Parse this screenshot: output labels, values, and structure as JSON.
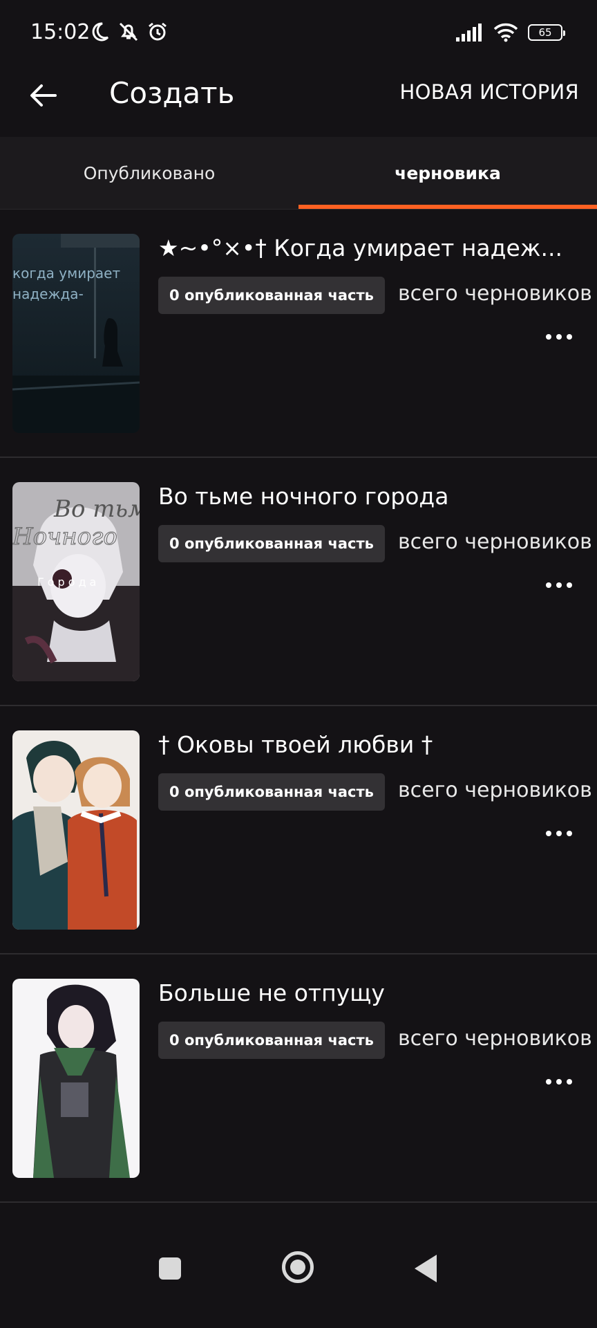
{
  "status_bar": {
    "time": "15:02",
    "battery": "65",
    "icons_left": [
      "moon-icon",
      "bell-off-icon",
      "alarm-icon"
    ],
    "icons_right": [
      "signal-icon",
      "wifi-icon",
      "battery-icon"
    ]
  },
  "app_bar": {
    "title": "Создать",
    "action_label": "НОВАЯ ИСТОРИЯ"
  },
  "tabs": {
    "published": "Опубликовано",
    "drafts": "черновика",
    "active": "drafts",
    "accent_color": "#ff6122"
  },
  "stories": [
    {
      "title": "★~•°×•† Когда умирает надеж...",
      "published_badge": "0 опубликованная часть",
      "drafts_label": "всего черновиков",
      "cover_text": [
        "когда умирает",
        "надежда-"
      ]
    },
    {
      "title": "Во тьме ночного города",
      "published_badge": "0 опубликованная часть",
      "drafts_label": "всего черновиков",
      "cover_text": [
        "Во тьме",
        "Ночного",
        "Города"
      ]
    },
    {
      "title": "† Оковы твоей любви †",
      "published_badge": "0 опубликованная часть",
      "drafts_label": "всего черновиков"
    },
    {
      "title": "Больше не отпущу",
      "published_badge": "0 опубликованная часть",
      "drafts_label": "всего черновиков"
    }
  ]
}
